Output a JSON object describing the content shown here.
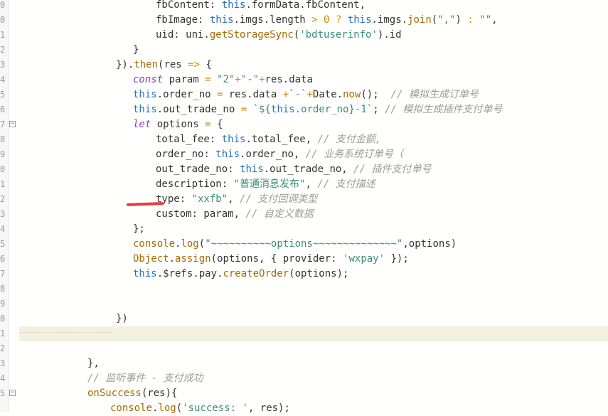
{
  "line_numbers": [
    "0",
    "0",
    "1",
    "2",
    "3",
    "4",
    "5",
    "6",
    "7",
    "8",
    "9",
    "0",
    "1",
    "2",
    "3",
    "4",
    "5",
    "6",
    "7",
    "8",
    "9",
    "0",
    "1",
    "2",
    "3",
    "4",
    "5"
  ],
  "lines": [
    {
      "indent": 219,
      "tokens": [
        [
          "p",
          "fbContent: "
        ],
        [
          "k",
          "this"
        ],
        [
          "p",
          ".formData.fbContent,"
        ]
      ]
    },
    {
      "indent": 219,
      "tokens": [
        [
          "p",
          "fbImage: "
        ],
        [
          "k",
          "this"
        ],
        [
          "p",
          ".imgs.length "
        ],
        [
          "o",
          ">"
        ],
        [
          "p",
          " "
        ],
        [
          "o",
          "0"
        ],
        [
          "p",
          " "
        ],
        [
          "o",
          "?"
        ],
        [
          "p",
          " "
        ],
        [
          "k",
          "this"
        ],
        [
          "p",
          ".imgs."
        ],
        [
          "f",
          "join"
        ],
        [
          "p",
          "("
        ],
        [
          "s",
          "\",\""
        ],
        [
          "p",
          ") "
        ],
        [
          "o",
          ":"
        ],
        [
          "p",
          " "
        ],
        [
          "s",
          "\"\""
        ],
        [
          "p",
          ","
        ]
      ]
    },
    {
      "indent": 219,
      "tokens": [
        [
          "p",
          "uid: uni."
        ],
        [
          "f",
          "getStorageSync"
        ],
        [
          "p",
          "("
        ],
        [
          "s",
          "'bdtuserinfo'"
        ],
        [
          "p",
          ").id"
        ]
      ]
    },
    {
      "indent": 187,
      "tokens": [
        [
          "p",
          "}"
        ]
      ]
    },
    {
      "indent": 163,
      "tokens": [
        [
          "p",
          "})."
        ],
        [
          "f",
          "then"
        ],
        [
          "p",
          "(res "
        ],
        [
          "o",
          "=>"
        ],
        [
          "p",
          " {"
        ]
      ]
    },
    {
      "indent": 187,
      "tokens": [
        [
          "kw",
          "const"
        ],
        [
          "p",
          " param "
        ],
        [
          "o",
          "="
        ],
        [
          "p",
          " "
        ],
        [
          "s",
          "\"2\""
        ],
        [
          "o",
          "+"
        ],
        [
          "s",
          "\"-\""
        ],
        [
          "o",
          "+"
        ],
        [
          "p",
          "res.data"
        ]
      ]
    },
    {
      "indent": 187,
      "tokens": [
        [
          "k",
          "this"
        ],
        [
          "p",
          ".order_no "
        ],
        [
          "o",
          "="
        ],
        [
          "p",
          " res.data "
        ],
        [
          "o",
          "+"
        ],
        [
          "s",
          "`-`"
        ],
        [
          "o",
          "+"
        ],
        [
          "p",
          "Date."
        ],
        [
          "f",
          "now"
        ],
        [
          "p",
          "();  "
        ],
        [
          "c",
          "// 模拟生成订单号"
        ]
      ]
    },
    {
      "indent": 187,
      "tokens": [
        [
          "k",
          "this"
        ],
        [
          "p",
          ".out_trade_no "
        ],
        [
          "o",
          "="
        ],
        [
          "p",
          " "
        ],
        [
          "s",
          "`${"
        ],
        [
          "k",
          "this"
        ],
        [
          "s",
          ".order_no}-1`"
        ],
        [
          "p",
          "; "
        ],
        [
          "c",
          "// 模拟生成插件支付单号"
        ]
      ]
    },
    {
      "indent": 187,
      "fold": true,
      "tokens": [
        [
          "kw",
          "let"
        ],
        [
          "p",
          " options "
        ],
        [
          "o",
          "="
        ],
        [
          "p",
          " {"
        ]
      ]
    },
    {
      "indent": 219,
      "tokens": [
        [
          "p",
          "total_fee: "
        ],
        [
          "k",
          "this"
        ],
        [
          "p",
          ".total_fee, "
        ],
        [
          "c",
          "// 支付金额,"
        ]
      ]
    },
    {
      "indent": 219,
      "tokens": [
        [
          "p",
          "order_no: "
        ],
        [
          "k",
          "this"
        ],
        [
          "p",
          ".order_no, "
        ],
        [
          "c",
          "// 业务系统订单号（"
        ]
      ]
    },
    {
      "indent": 219,
      "tokens": [
        [
          "p",
          "out_trade_no: "
        ],
        [
          "k",
          "this"
        ],
        [
          "p",
          ".out_trade_no, "
        ],
        [
          "c",
          "// 插件支付单号"
        ]
      ]
    },
    {
      "indent": 219,
      "tokens": [
        [
          "p",
          "description: "
        ],
        [
          "s",
          "\"普通消息发布\""
        ],
        [
          "p",
          ", "
        ],
        [
          "c",
          "// 支付描述"
        ]
      ]
    },
    {
      "indent": 219,
      "tokens": [
        [
          "p",
          "type: "
        ],
        [
          "s",
          "\"xxfb\""
        ],
        [
          "p",
          ", "
        ],
        [
          "c",
          "// 支付回调类型"
        ]
      ]
    },
    {
      "indent": 219,
      "tokens": [
        [
          "p",
          "custom: param, "
        ],
        [
          "c",
          "// 自定义数据"
        ]
      ]
    },
    {
      "indent": 187,
      "tokens": [
        [
          "p",
          "};"
        ]
      ]
    },
    {
      "indent": 187,
      "tokens": [
        [
          "f",
          "console"
        ],
        [
          "p",
          "."
        ],
        [
          "f",
          "log"
        ],
        [
          "p",
          "("
        ],
        [
          "s",
          "\"~~~~~~~~~~options~~~~~~~~~~~~~~\""
        ],
        [
          "p",
          ",options)"
        ]
      ]
    },
    {
      "indent": 187,
      "tokens": [
        [
          "f",
          "Object"
        ],
        [
          "p",
          "."
        ],
        [
          "f",
          "assign"
        ],
        [
          "p",
          "(options, { provider: "
        ],
        [
          "s",
          "'wxpay'"
        ],
        [
          "p",
          " });"
        ]
      ]
    },
    {
      "indent": 187,
      "tokens": [
        [
          "k",
          "this"
        ],
        [
          "p",
          ".$refs.pay."
        ],
        [
          "f",
          "createOrder"
        ],
        [
          "p",
          "(options);"
        ]
      ]
    },
    {
      "indent": 187,
      "tokens": []
    },
    {
      "indent": 187,
      "tokens": []
    },
    {
      "indent": 163,
      "tokens": [
        [
          "p",
          "})"
        ]
      ]
    },
    {
      "indent": 163,
      "current": true,
      "tokens": []
    },
    {
      "indent": 123,
      "tokens": []
    },
    {
      "indent": 123,
      "tokens": [
        [
          "p",
          "},"
        ]
      ]
    },
    {
      "indent": 123,
      "tokens": [
        [
          "c",
          "// 监听事件 - 支付成功"
        ]
      ]
    },
    {
      "indent": 123,
      "fold": true,
      "tokens": [
        [
          "f",
          "onSuccess"
        ],
        [
          "p",
          "(res){"
        ]
      ]
    },
    {
      "indent": 155,
      "tokens": [
        [
          "f",
          "console"
        ],
        [
          "p",
          "."
        ],
        [
          "f",
          "log"
        ],
        [
          "p",
          "("
        ],
        [
          "s",
          "'success: '"
        ],
        [
          "p",
          ", res);"
        ]
      ]
    }
  ]
}
